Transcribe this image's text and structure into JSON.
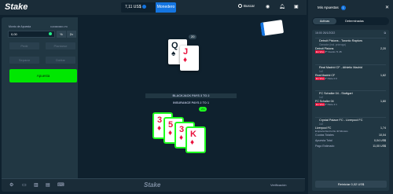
{
  "topbar": {
    "logo": "Stake",
    "balance": "7,11 US$",
    "wallet_label": "Monedero",
    "search_label": "Buscar",
    "user_icon": "user-icon",
    "bell_icon": "bell-icon",
    "chat_icon": "chat-icon"
  },
  "bet_panel": {
    "amount_label": "Monto de Apuesta",
    "amount_right": "0,00000000 LTC",
    "amount_value": "0,00",
    "half_label": "½",
    "double_label": "2×",
    "actions": [
      {
        "name": "hit",
        "label": "Pedir"
      },
      {
        "name": "stand",
        "label": "Plantarse"
      },
      {
        "name": "split",
        "label": "Separar"
      },
      {
        "name": "double",
        "label": "Doblar"
      }
    ],
    "bet_button": "Apuesta"
  },
  "table": {
    "dealer_count": "20",
    "player_count": "21",
    "banner1": "BLACKJACK PAYS 3 TO 2",
    "banner2": "INSURANCE PAYS 2 TO 1",
    "dealer_cards": [
      {
        "rank": "Q",
        "suit": "♠",
        "color": "#0f212e"
      },
      {
        "rank": "J",
        "suit": "♦",
        "color": "#e9113c"
      }
    ],
    "player_cards": [
      {
        "rank": "3",
        "suit": "♦",
        "color": "#e9113c"
      },
      {
        "rank": "5",
        "suit": "♦",
        "color": "#e9113c"
      },
      {
        "rank": "3",
        "suit": "♦",
        "color": "#e9113c"
      },
      {
        "rank": "K",
        "suit": "♦",
        "color": "#e9113c"
      }
    ]
  },
  "bottombar": {
    "logo": "Stake",
    "fairness": "Verificación",
    "icons": [
      "gear-icon",
      "theater-icon",
      "chart-icon",
      "stats-icon",
      "keyboard-icon"
    ]
  },
  "sidebar": {
    "title": "Mis Apuestas",
    "badge": "1",
    "tabs": [
      "Activas",
      "Determinadas"
    ],
    "slip": {
      "date": "16:00 26/1/2022",
      "id": "⧉",
      "matches": [
        {
          "title": "Detroit Pistons - Toronto Raptors",
          "desc": "Ganador (incl. prórroga)",
          "pick": "Detroit Pistons",
          "odds": "2,20",
          "score": "3ᵉʳ Cuarto  71 45"
        },
        {
          "title": "Real Madrid CF - Athletic Madrid",
          "desc": "1x2",
          "pick": "Real Madrid CF",
          "odds": "1,62",
          "score": "2ᵒ Parte  0 0"
        },
        {
          "title": "FC Schalke 04 - Stuttgart",
          "desc": "1x2",
          "pick": "FC Schalke 04",
          "odds": "1,60",
          "score": "2ᵒ Parte  2 1"
        },
        {
          "title": "Crystal Palace FC - Liverpool FC",
          "desc": "1x2",
          "pick": "Liverpool FC",
          "odds": "1,74",
          "score": "Empieza Dentro De 40 Minutos"
        }
      ],
      "live_label": "En Vivo",
      "totals": [
        {
          "label": "Cuotas Totales",
          "value": "10,04"
        },
        {
          "label": "Apuesta Total",
          "value": "0,04 US$"
        },
        {
          "label": "Pago Estimado",
          "value": "11,00 US$"
        }
      ],
      "reuse_label": "Reiniciar 0,02 US$"
    }
  }
}
